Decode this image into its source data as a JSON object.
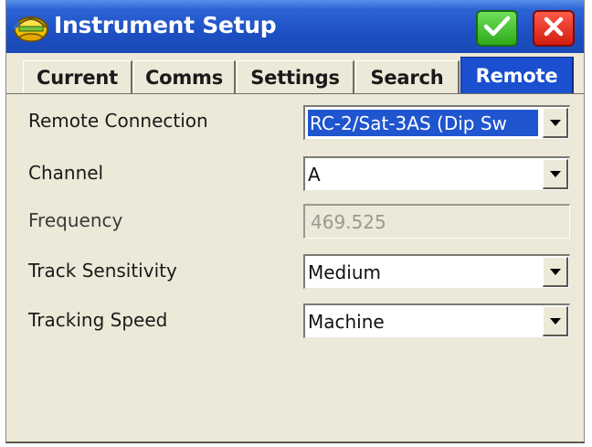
{
  "window": {
    "title": "Instrument Setup",
    "icons": {
      "app": "helmet-icon",
      "ok": "checkmark-icon",
      "cancel": "close-icon"
    },
    "colors": {
      "titlebar": "#1e50c4",
      "ok": "#2eaa1a",
      "cancel": "#d21c10",
      "active_tab": "#1a4fd0"
    }
  },
  "tabs": [
    {
      "label": "Current",
      "active": false
    },
    {
      "label": "Comms",
      "active": false
    },
    {
      "label": "Settings",
      "active": false
    },
    {
      "label": "Search",
      "active": false
    },
    {
      "label": "Remote",
      "active": true
    }
  ],
  "form": {
    "remote_connection": {
      "label": "Remote Connection",
      "value": "RC-2/Sat-3AS (Dip Sw"
    },
    "channel": {
      "label": "Channel",
      "value": "A"
    },
    "frequency": {
      "label": "Frequency",
      "value": "469.525",
      "disabled": true
    },
    "track_sensitivity": {
      "label": "Track Sensitivity",
      "value": "Medium"
    },
    "tracking_speed": {
      "label": "Tracking Speed",
      "value": "Machine"
    }
  }
}
